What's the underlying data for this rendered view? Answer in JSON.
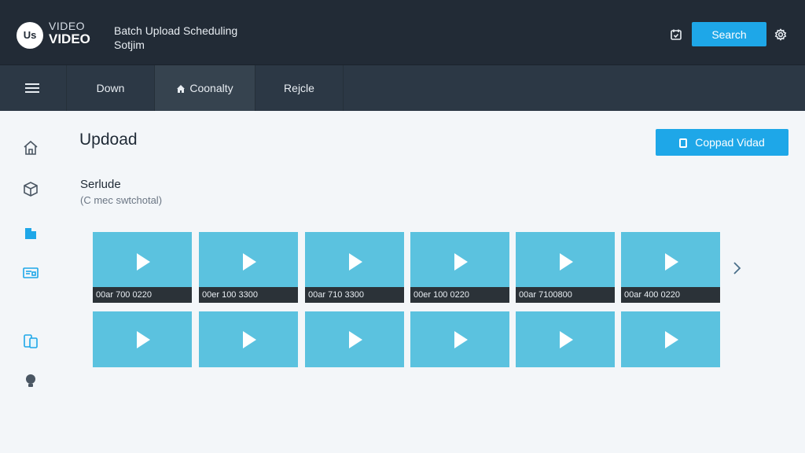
{
  "header": {
    "logo_badge": "Us",
    "logo_line1": "VIDEO",
    "logo_line2": "VIDEO",
    "title_line1": "Batch Upload Scheduling",
    "title_line2": "Sotjim",
    "search_label": "Search"
  },
  "nav": {
    "tabs": [
      {
        "label": "Down"
      },
      {
        "label": "Coonalty"
      },
      {
        "label": "Rejcle"
      }
    ]
  },
  "sidebar": {
    "icons": [
      "home-icon",
      "package-icon",
      "document-icon",
      "monitor-icon",
      "devices-icon",
      "lightbulb-icon"
    ]
  },
  "main": {
    "title": "Updoad",
    "upload_button": "Coppad Vidad",
    "section_title": "Serlude",
    "section_sub": "(C mec swtchotal)",
    "row1": [
      {
        "caption": "00ar 700 0220"
      },
      {
        "caption": "00er 100 3300"
      },
      {
        "caption": "00ar 710 3300"
      },
      {
        "caption": "00er 100 0220"
      },
      {
        "caption": "00ar 7100800"
      },
      {
        "caption": "00ar 400 0220"
      }
    ],
    "row2_count": 6
  },
  "colors": {
    "header_bg": "#222b36",
    "nav_bg": "#2c3845",
    "accent": "#1ea7e8",
    "thumbnail": "#5bc2df"
  }
}
